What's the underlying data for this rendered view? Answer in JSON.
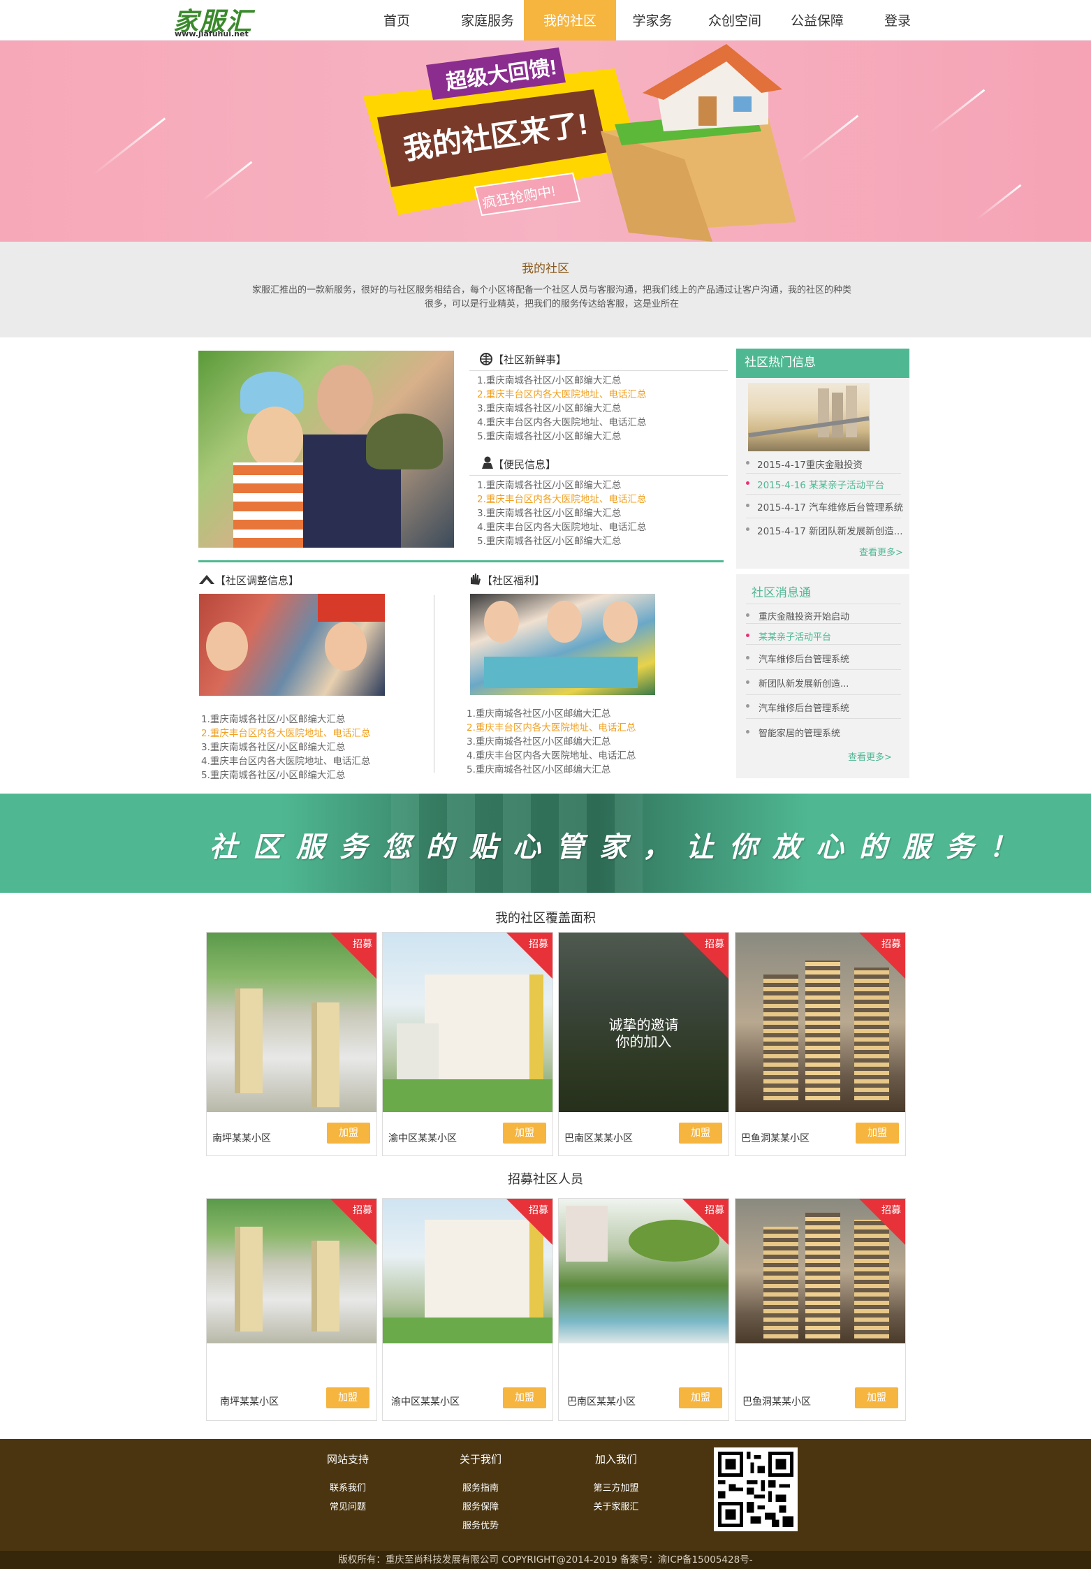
{
  "header": {
    "logo_text": "家服汇",
    "logo_url": "www.jiafuhui.net",
    "nav": [
      {
        "label": "首页"
      },
      {
        "label": "家庭服务"
      },
      {
        "label": "我的社区"
      },
      {
        "label": "学家务"
      },
      {
        "label": "众创空间"
      },
      {
        "label": "公益保障"
      },
      {
        "label": "登录"
      }
    ],
    "active_nav": "我的社区"
  },
  "banner": {
    "tag_top": "超级大回馈!",
    "headline": "我的社区来了!",
    "tag_bottom": "疯狂抢购中!"
  },
  "intro": {
    "title": "我的社区",
    "text": "家服汇推出的一款新服务，很好的与社区服务相结合，每个小区将配备一个社区人员与客服沟通，把我们线上的产品通过让客户沟通，我的社区的种类很多，可以是行业精英，把我们的服务传达给客服，这是业所在"
  },
  "news": {
    "title": "【社区新鲜事】",
    "items": [
      "1.重庆南城各社区/小区邮编大汇总",
      "2.重庆丰台区内各大医院地址、电话汇总",
      "3.重庆南城各社区/小区邮编大汇总",
      "4.重庆丰台区内各大医院地址、电话汇总",
      "5.重庆南城各社区/小区邮编大汇总"
    ]
  },
  "convenience": {
    "title": "【便民信息】",
    "items": [
      "1.重庆南城各社区/小区邮编大汇总",
      "2.重庆丰台区内各大医院地址、电话汇总",
      "3.重庆南城各社区/小区邮编大汇总",
      "4.重庆丰台区内各大医院地址、电话汇总",
      "5.重庆南城各社区/小区邮编大汇总"
    ]
  },
  "adjust": {
    "title": "【社区调整信息】",
    "items": [
      "1.重庆南城各社区/小区邮编大汇总",
      "2.重庆丰台区内各大医院地址、电话汇总",
      "3.重庆南城各社区/小区邮编大汇总",
      "4.重庆丰台区内各大医院地址、电话汇总",
      "5.重庆南城各社区/小区邮编大汇总"
    ]
  },
  "welfare": {
    "title": "【社区福利】",
    "items": [
      "1.重庆南城各社区/小区邮编大汇总",
      "2.重庆丰台区内各大医院地址、电话汇总",
      "3.重庆南城各社区/小区邮编大汇总",
      "4.重庆丰台区内各大医院地址、电话汇总",
      "5.重庆南城各社区/小区邮编大汇总"
    ]
  },
  "hot": {
    "title": "社区热门信息",
    "items": [
      "2015-4-17重庆金融投资",
      "2015-4-16  某某亲子活动平台",
      "2015-4-17 汽车维修后台管理系统",
      "2015-4-17 新团队新发展新创造..."
    ],
    "more": "查看更多>"
  },
  "messages": {
    "title": "社区消息通",
    "items": [
      "重庆金融投资开始启动",
      "某某亲子活动平台",
      "汽车维修后台管理系统",
      "新团队新发展新创造...",
      "汽车维修后台管理系统",
      "智能家居的管理系统"
    ],
    "more": "查看更多>"
  },
  "slogan": "社区服务您的贴心管家，让你放心的服务！",
  "coverage": {
    "title": "我的社区覆盖面积",
    "overlay_text_1": "诚挚的邀请",
    "overlay_text_2": "你的加入",
    "cards": [
      {
        "name": "南坪某某小区",
        "tag": "招募",
        "button": "加盟"
      },
      {
        "name": "渝中区某某小区",
        "tag": "招募",
        "button": "加盟"
      },
      {
        "name": "巴南区某某小区",
        "tag": "招募",
        "button": "加盟"
      },
      {
        "name": "巴鱼洞某某小区",
        "tag": "招募",
        "button": "加盟"
      }
    ]
  },
  "recruit": {
    "title": "招募社区人员",
    "cards": [
      {
        "name": "南坪某某小区",
        "tag": "招募",
        "button": "加盟"
      },
      {
        "name": "渝中区某某小区",
        "tag": "招募",
        "button": "加盟"
      },
      {
        "name": "巴南区某某小区",
        "tag": "招募",
        "button": "加盟"
      },
      {
        "name": "巴鱼洞某某小区",
        "tag": "招募",
        "button": "加盟"
      }
    ]
  },
  "footer": {
    "cols": [
      {
        "title": "网站支持",
        "items": [
          "联系我们",
          "常见问题"
        ]
      },
      {
        "title": "关于我们",
        "items": [
          "服务指南",
          "服务保障",
          "服务优势"
        ]
      },
      {
        "title": "加入我们",
        "items": [
          "第三方加盟",
          "关于家服汇"
        ]
      }
    ],
    "copyright": "版权所有：重庆至尚科技发展有限公司 COPYRIGHT@2014-2019 备案号：渝ICP备15005428号-"
  },
  "colors": {
    "accent": "#f5b53f",
    "green": "#4fb893",
    "footer": "#4a3510",
    "banner_pink": "#f7a8b8",
    "tag_red": "#e8323a"
  }
}
